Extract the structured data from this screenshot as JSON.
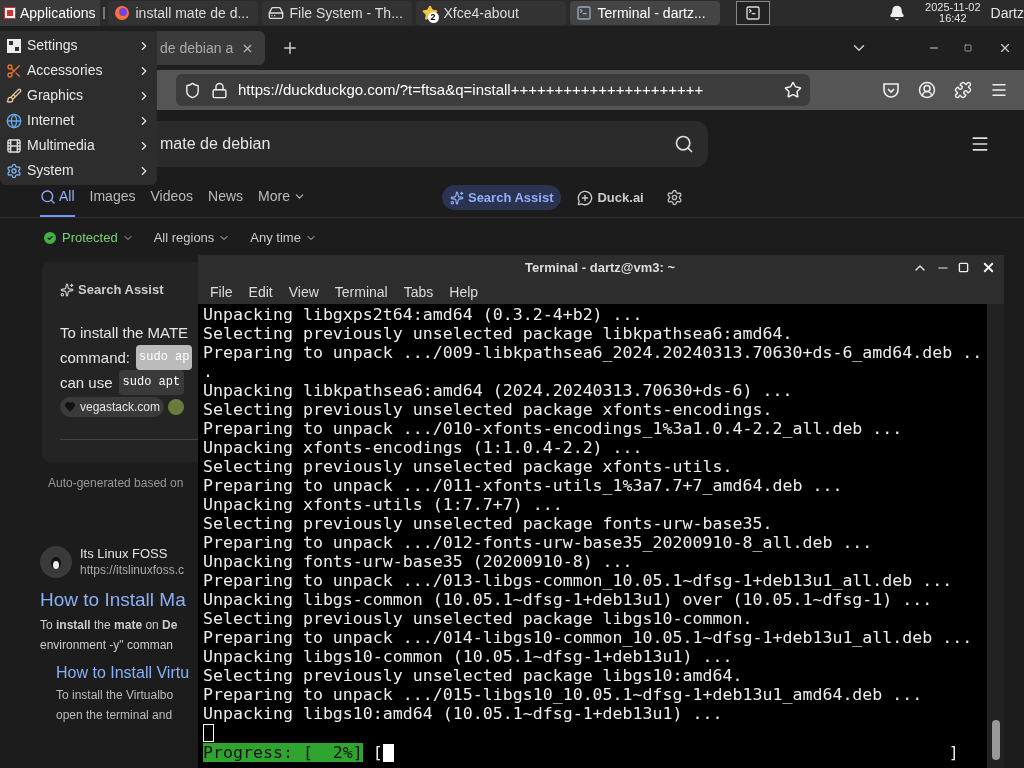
{
  "panel": {
    "apps_button": "Applications",
    "tasks": [
      {
        "label": "install mate de d...",
        "kind": "firefox",
        "selected": false
      },
      {
        "label": "File System - Th...",
        "kind": "drive",
        "selected": false
      },
      {
        "label": "Xfce4-about",
        "kind": "star",
        "badge": "2",
        "selected": false
      },
      {
        "label": "Terminal - dartz...",
        "kind": "terminal",
        "selected": true
      }
    ],
    "date": "2025-11-02",
    "time": "16:42",
    "user": "Dartz"
  },
  "menu": {
    "items": [
      {
        "label": "Settings",
        "kind": "settings"
      },
      {
        "label": "Accessories",
        "kind": "accessories"
      },
      {
        "label": "Graphics",
        "kind": "graphics"
      },
      {
        "label": "Internet",
        "kind": "internet"
      },
      {
        "label": "Multimedia",
        "kind": "multimedia"
      },
      {
        "label": "System",
        "kind": "system"
      }
    ]
  },
  "browser": {
    "tab": {
      "title": "de debian a"
    },
    "url": "https://duckduckgo.com/?t=ftsa&q=install++++++++++++++++++++++",
    "search": {
      "value": "mate de debian"
    },
    "nav": [
      {
        "label": "All",
        "selected": true
      },
      {
        "label": "Images",
        "selected": false
      },
      {
        "label": "Videos",
        "selected": false
      },
      {
        "label": "News",
        "selected": false
      },
      {
        "label": "More",
        "selected": false
      }
    ],
    "assist_button": "Search Assist",
    "duck_ai": "Duck.ai",
    "filters": [
      {
        "label": "Protected",
        "kind": "status"
      },
      {
        "label": "All regions",
        "kind": "dropdown"
      },
      {
        "label": "Any time",
        "kind": "dropdown"
      }
    ],
    "assist_card": {
      "title": "Search Assist",
      "line_1": "To install the MATE",
      "line_2": "command:",
      "code_1": "sudo ap",
      "line_3": "can use",
      "code_2": "sudo apt",
      "source": "vegastack.com",
      "footer": "Auto-generated based on"
    },
    "result": {
      "site": "Its Linux FOSS",
      "url": "https://itslinuxfoss.c",
      "title": "How to Install Ma",
      "snippet": [
        "To **install** the **mate** on **De**",
        "environment -y\" comman"
      ],
      "sub_title": "How to Install Virtu",
      "sub_snippet": [
        "To install the Virtualbo",
        "open the terminal and"
      ]
    }
  },
  "terminal": {
    "title": "Terminal - dartz@vm3: ~",
    "menus": [
      "File",
      "Edit",
      "View",
      "Terminal",
      "Tabs",
      "Help"
    ],
    "lines": [
      "Unpacking libgxps2t64:amd64 (0.3.2-4+b2) ...",
      "Selecting previously unselected package libkpathsea6:amd64.",
      "Preparing to unpack .../009-libkpathsea6_2024.20240313.70630+ds-6_amd64.deb ..",
      ".",
      "Unpacking libkpathsea6:amd64 (2024.20240313.70630+ds-6) ...",
      "Selecting previously unselected package xfonts-encodings.",
      "Preparing to unpack .../010-xfonts-encodings_1%3a1.0.4-2.2_all.deb ...",
      "Unpacking xfonts-encodings (1:1.0.4-2.2) ...",
      "Selecting previously unselected package xfonts-utils.",
      "Preparing to unpack .../011-xfonts-utils_1%3a7.7+7_amd64.deb ...",
      "Unpacking xfonts-utils (1:7.7+7) ...",
      "Selecting previously unselected package fonts-urw-base35.",
      "Preparing to unpack .../012-fonts-urw-base35_20200910-8_all.deb ...",
      "Unpacking fonts-urw-base35 (20200910-8) ...",
      "Preparing to unpack .../013-libgs-common_10.05.1~dfsg-1+deb13u1_all.deb ...",
      "Unpacking libgs-common (10.05.1~dfsg-1+deb13u1) over (10.05.1~dfsg-1) ...",
      "Selecting previously unselected package libgs10-common.",
      "Preparing to unpack .../014-libgs10-common_10.05.1~dfsg-1+deb13u1_all.deb ...",
      "Unpacking libgs10-common (10.05.1~dfsg-1+deb13u1) ...",
      "Selecting previously unselected package libgs10:amd64.",
      "Preparing to unpack .../015-libgs10_10.05.1~dfsg-1+deb13u1_amd64.deb ...",
      "Unpacking libgs10:amd64 (10.05.1~dfsg-1+deb13u1) ..."
    ],
    "progress": {
      "label": "Progress: [  2%]",
      "open": "[",
      "close": "]"
    }
  }
}
